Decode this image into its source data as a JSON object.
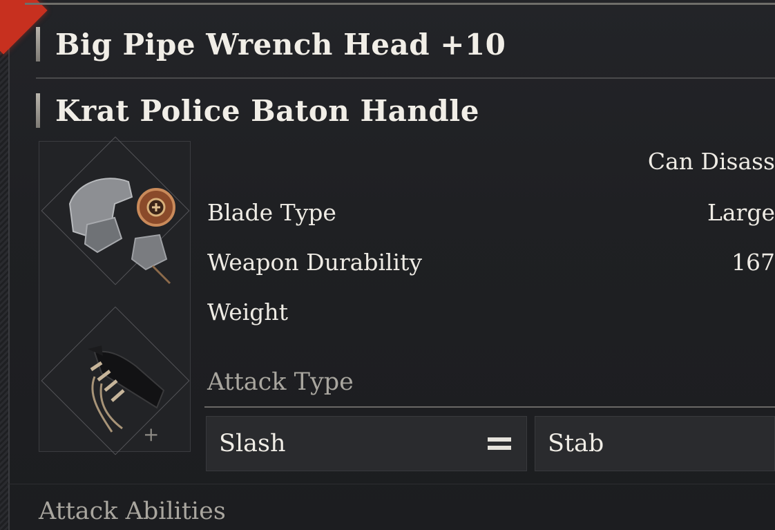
{
  "item": {
    "blade_name": "Big Pipe Wrench Head +10",
    "handle_name": "Krat Police Baton Handle"
  },
  "stats": {
    "disassemble": "Can Disass",
    "blade_type_label": "Blade Type",
    "blade_type_value": "Large",
    "durability_label": "Weapon Durability",
    "durability_value": "167",
    "weight_label": "Weight"
  },
  "attack_type": {
    "heading": "Attack Type",
    "primary": "Slash",
    "secondary": "Stab"
  },
  "abilities": {
    "heading": "Attack Abilities"
  },
  "colors": {
    "accent": "#c7301f",
    "background": "#1c1d20"
  },
  "icons": {
    "blade": "pipe-wrench-head-icon",
    "handle": "baton-handle-icon",
    "combine": "plus-icon",
    "equal": "equals-icon"
  }
}
